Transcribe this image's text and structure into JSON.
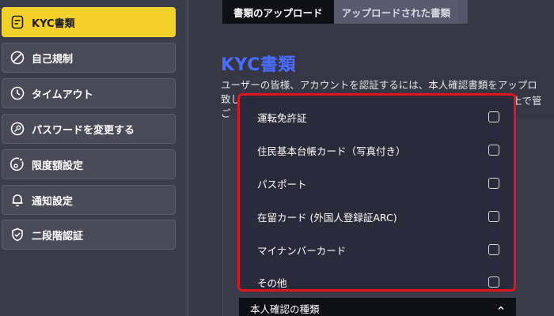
{
  "sidebar": {
    "items": [
      {
        "label": "KYC書類",
        "icon": "document-icon",
        "active": true
      },
      {
        "label": "自己規制",
        "icon": "ban-icon",
        "active": false
      },
      {
        "label": "タイムアウト",
        "icon": "clock-icon",
        "active": false
      },
      {
        "label": "パスワードを変更する",
        "icon": "key-icon",
        "active": false
      },
      {
        "label": "限度額設定",
        "icon": "limit-icon",
        "active": false
      },
      {
        "label": "通知設定",
        "icon": "bell-icon",
        "active": false
      },
      {
        "label": "二段階認証",
        "icon": "shield-icon",
        "active": false
      }
    ]
  },
  "tabs": {
    "upload": "書類のアップロード",
    "uploaded": "アップロードされた書類"
  },
  "page": {
    "title": "KYC書類",
    "desc_line1": "ユーザーの皆様、アカウントを認証するには、本人確認書類をアップロ",
    "desc_line2": "致し",
    "desc_line2_right": "上で管",
    "desc_line3": "ご"
  },
  "dropdown": {
    "options": [
      "運転免許証",
      "住民基本台帳カード（写真付き）",
      "パスポート",
      "在留カード (外国人登録証ARC)",
      "マイナンバーカード",
      "その他"
    ],
    "select_label": "本人確認の種類"
  },
  "colors": {
    "accent_yellow": "#f3d02a",
    "title_blue": "#4a6cff",
    "highlight_red": "#e0161d"
  }
}
